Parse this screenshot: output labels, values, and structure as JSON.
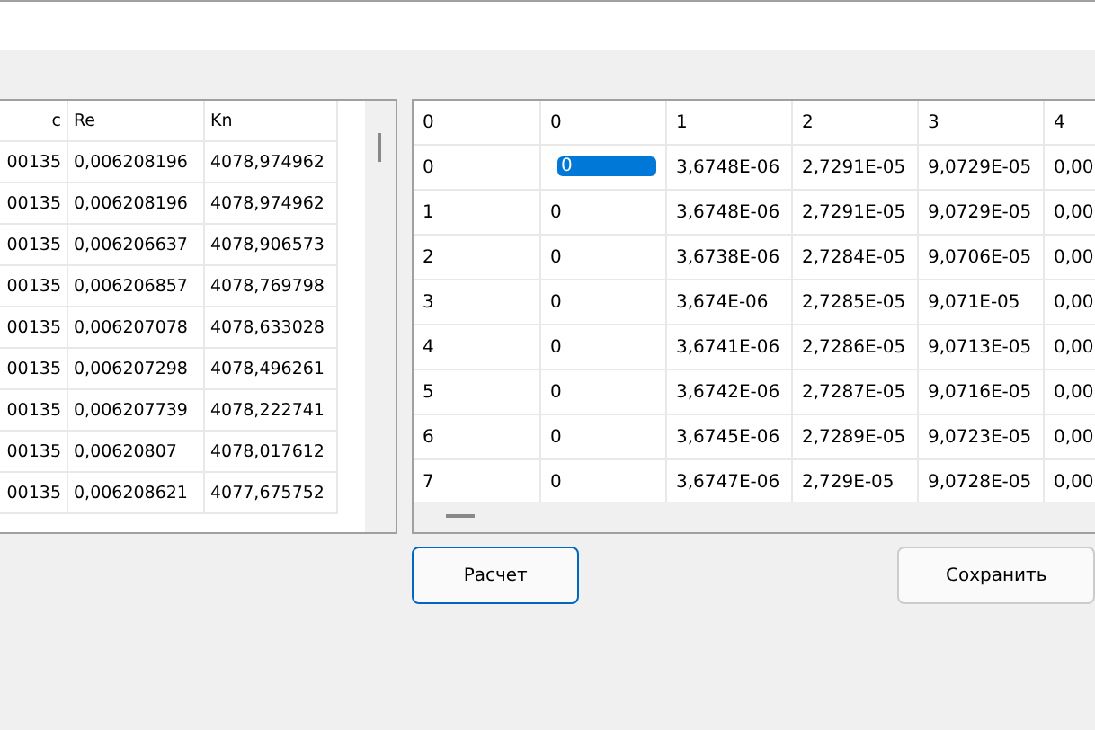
{
  "left_table": {
    "columns": [
      "c",
      "Re",
      "Kn"
    ],
    "rows": [
      [
        "00135",
        "0,006208196",
        "4078,974962"
      ],
      [
        "00135",
        "0,006208196",
        "4078,974962"
      ],
      [
        "00135",
        "0,006206637",
        "4078,906573"
      ],
      [
        "00135",
        "0,006206857",
        "4078,769798"
      ],
      [
        "00135",
        "0,006207078",
        "4078,633028"
      ],
      [
        "00135",
        "0,006207298",
        "4078,496261"
      ],
      [
        "00135",
        "0,006207739",
        "4078,222741"
      ],
      [
        "00135",
        "0,00620807",
        "4078,017612"
      ],
      [
        "00135",
        "0,006208621",
        "4077,675752"
      ]
    ]
  },
  "right_table": {
    "columns": [
      "0",
      "0",
      "1",
      "2",
      "3",
      "4"
    ],
    "rows": [
      {
        "cells": [
          {
            "text": "0",
            "selected": false
          },
          {
            "text": "0",
            "selected": true
          },
          {
            "text": "3,6748E-06",
            "selected": false
          },
          {
            "text": "2,7291E-05",
            "selected": false
          },
          {
            "text": "9,0729E-05",
            "selected": false
          },
          {
            "text": "0,00",
            "selected": false
          }
        ]
      },
      {
        "cells": [
          {
            "text": "1",
            "selected": false
          },
          {
            "text": "0",
            "selected": false
          },
          {
            "text": "3,6748E-06",
            "selected": false
          },
          {
            "text": "2,7291E-05",
            "selected": false
          },
          {
            "text": "9,0729E-05",
            "selected": false
          },
          {
            "text": "0,00",
            "selected": false
          }
        ]
      },
      {
        "cells": [
          {
            "text": "2",
            "selected": false
          },
          {
            "text": "0",
            "selected": false
          },
          {
            "text": "3,6738E-06",
            "selected": false
          },
          {
            "text": "2,7284E-05",
            "selected": false
          },
          {
            "text": "9,0706E-05",
            "selected": false
          },
          {
            "text": "0,00",
            "selected": false
          }
        ]
      },
      {
        "cells": [
          {
            "text": "3",
            "selected": false
          },
          {
            "text": "0",
            "selected": false
          },
          {
            "text": "3,674E-06",
            "selected": false
          },
          {
            "text": "2,7285E-05",
            "selected": false
          },
          {
            "text": "9,071E-05",
            "selected": false
          },
          {
            "text": "0,00",
            "selected": false
          }
        ]
      },
      {
        "cells": [
          {
            "text": "4",
            "selected": false
          },
          {
            "text": "0",
            "selected": false
          },
          {
            "text": "3,6741E-06",
            "selected": false
          },
          {
            "text": "2,7286E-05",
            "selected": false
          },
          {
            "text": "9,0713E-05",
            "selected": false
          },
          {
            "text": "0,00",
            "selected": false
          }
        ]
      },
      {
        "cells": [
          {
            "text": "5",
            "selected": false
          },
          {
            "text": "0",
            "selected": false
          },
          {
            "text": "3,6742E-06",
            "selected": false
          },
          {
            "text": "2,7287E-05",
            "selected": false
          },
          {
            "text": "9,0716E-05",
            "selected": false
          },
          {
            "text": "0,00",
            "selected": false
          }
        ]
      },
      {
        "cells": [
          {
            "text": "6",
            "selected": false
          },
          {
            "text": "0",
            "selected": false
          },
          {
            "text": "3,6745E-06",
            "selected": false
          },
          {
            "text": "2,7289E-05",
            "selected": false
          },
          {
            "text": "9,0723E-05",
            "selected": false
          },
          {
            "text": "0,00",
            "selected": false
          }
        ]
      },
      {
        "cells": [
          {
            "text": "7",
            "selected": false
          },
          {
            "text": "0",
            "selected": false
          },
          {
            "text": "3,6747E-06",
            "selected": false
          },
          {
            "text": "2,729E-05",
            "selected": false
          },
          {
            "text": "9,0728E-05",
            "selected": false
          },
          {
            "text": "0,00",
            "selected": false
          }
        ]
      }
    ]
  },
  "buttons": [
    {
      "label": "Расчет",
      "focused": true
    },
    {
      "label": "Сохранить",
      "focused": false
    }
  ]
}
